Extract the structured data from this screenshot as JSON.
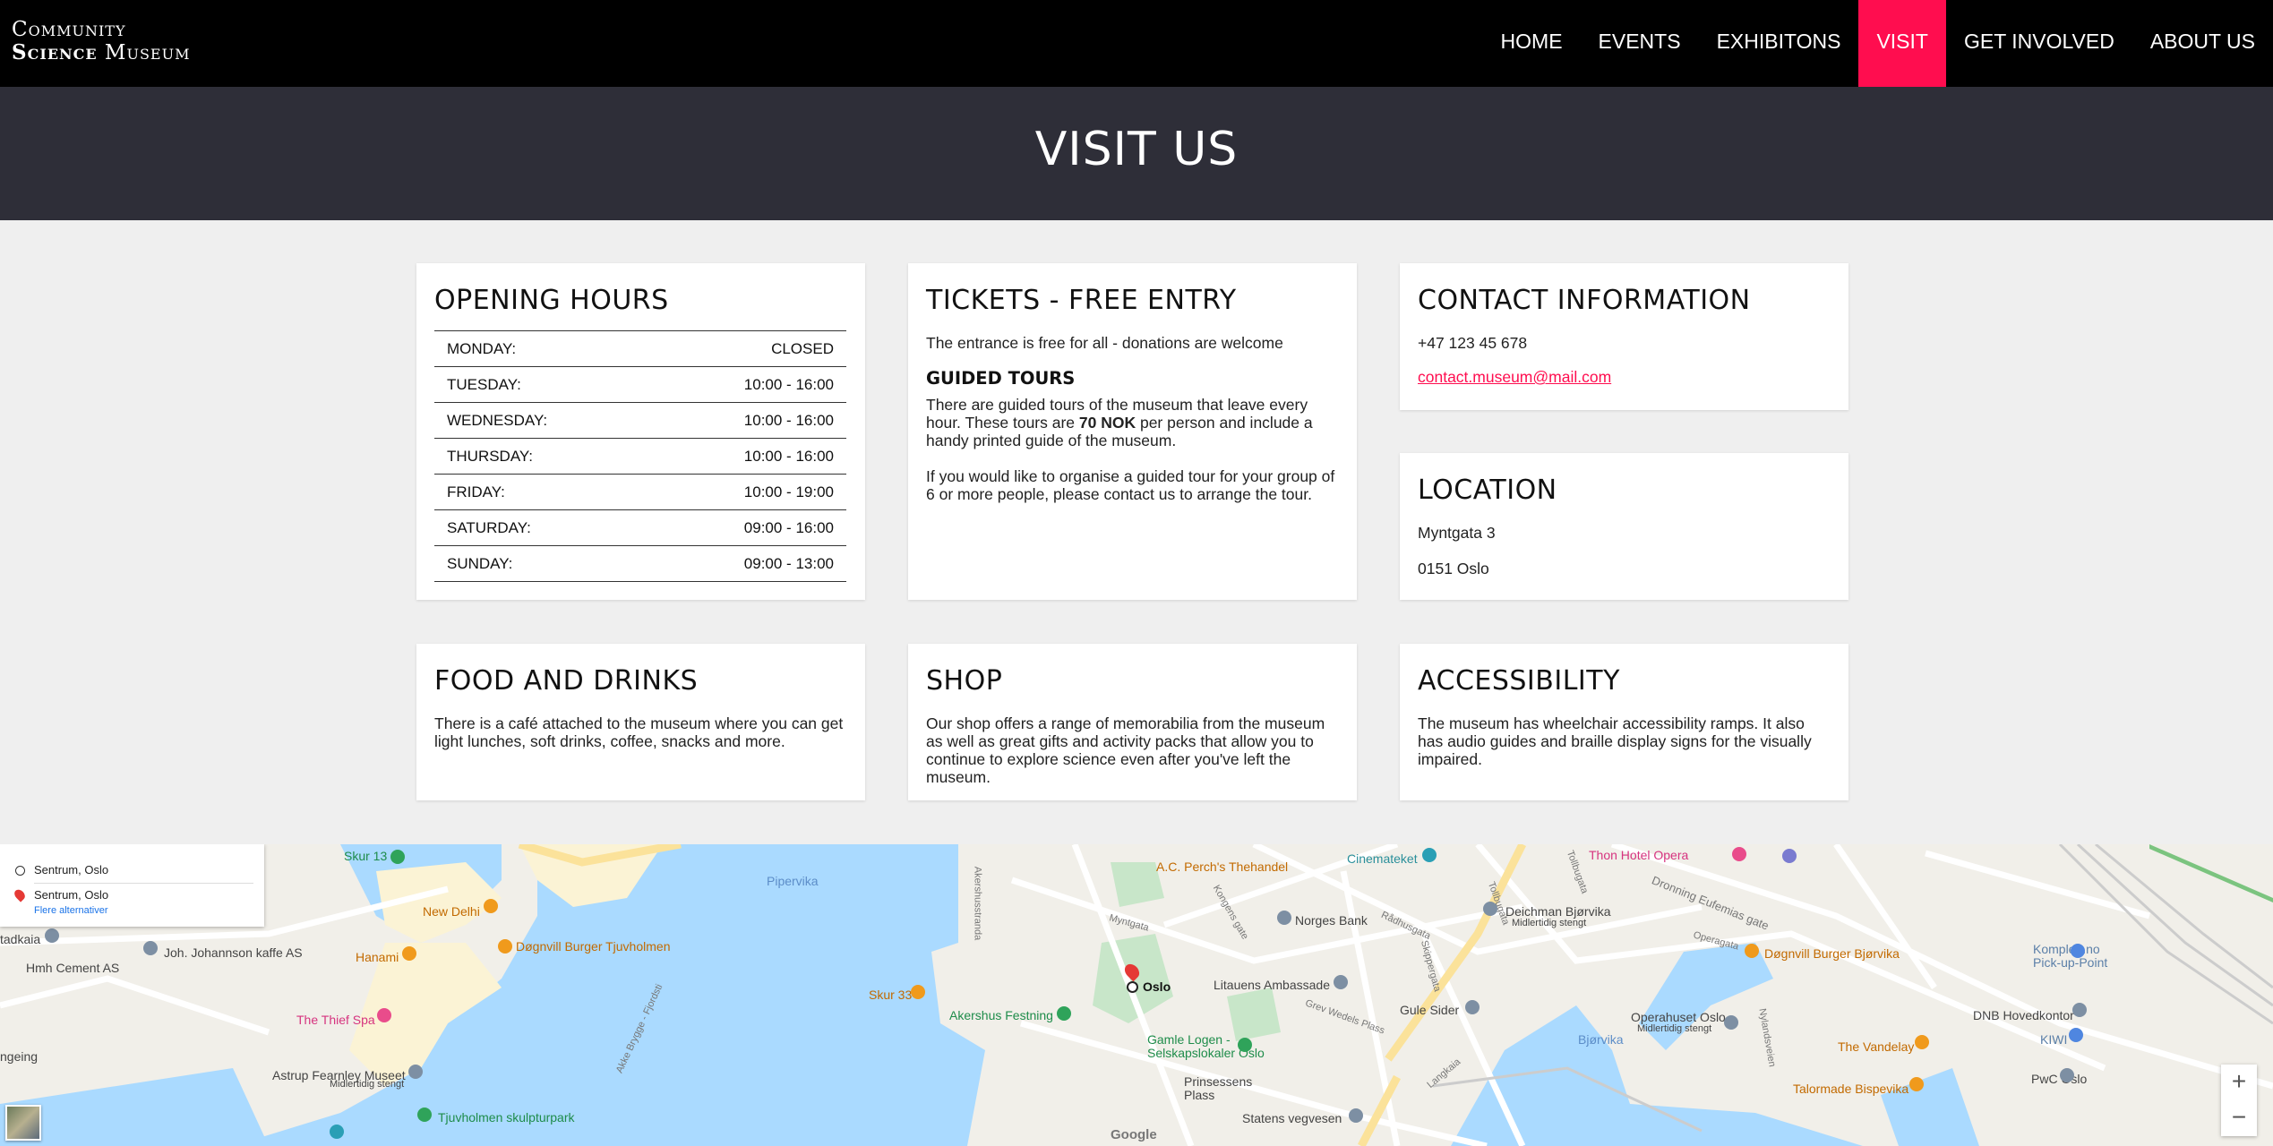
{
  "nav": {
    "logo_line1": "Community",
    "logo_line2_bold": "Science",
    "logo_line2_rest": "Museum",
    "items": [
      {
        "label": "HOME"
      },
      {
        "label": "EVENTS"
      },
      {
        "label": "EXHIBITONS"
      },
      {
        "label": "VISIT",
        "active": true
      },
      {
        "label": "GET INVOLVED"
      },
      {
        "label": "ABOUT US"
      }
    ],
    "active_color": "#ff0d4f"
  },
  "hero": {
    "title": "VISIT US"
  },
  "hours": {
    "title": "OPENING HOURS",
    "rows": [
      {
        "day": "MONDAY:",
        "time": "CLOSED"
      },
      {
        "day": "TUESDAY:",
        "time": "10:00 - 16:00"
      },
      {
        "day": "WEDNESDAY:",
        "time": "10:00 - 16:00"
      },
      {
        "day": "THURSDAY:",
        "time": "10:00 - 16:00"
      },
      {
        "day": "FRIDAY:",
        "time": "10:00 - 19:00"
      },
      {
        "day": "SATURDAY:",
        "time": "09:00 - 16:00"
      },
      {
        "day": "SUNDAY:",
        "time": "09:00 - 13:00"
      }
    ]
  },
  "tickets": {
    "title": "TICKETS - FREE ENTRY",
    "intro": "The entrance is free for all - donations are welcome",
    "tours_title": "GUIDED TOURS",
    "tours_p1_a": "There are guided tours of the museum that leave every hour. These tours are ",
    "tours_p1_bold": "70 NOK",
    "tours_p1_b": " per person and include a handy printed guide of the museum.",
    "tours_p2": "If you would like to organise a guided tour for your group of 6 or more people, please contact us to arrange the tour."
  },
  "contact": {
    "title": "CONTACT INFORMATION",
    "phone": "+47 123 45 678",
    "email": "contact.museum@mail.com"
  },
  "location": {
    "title": "LOCATION",
    "street": "Myntgata 3",
    "city": "0151 Oslo"
  },
  "food": {
    "title": "FOOD AND DRINKS",
    "text": "There is a café attached to the museum where you can get light lunches, soft drinks, coffee, snacks and more."
  },
  "shop": {
    "title": "SHOP",
    "text": "Our shop offers a range of memorabilia from the museum as well as great gifts and activity packs that allow you to continue to explore science even after you've left the museum."
  },
  "access": {
    "title": "ACCESSIBILITY",
    "text": "The museum has wheelchair accessibility ramps. It also has audio guides and braille display signs for the visually impaired."
  },
  "map": {
    "dir_from": "Sentrum, Oslo",
    "dir_to": "Sentrum, Oslo",
    "dir_more": "Flere alternativer",
    "pin_label": "Oslo",
    "labels": [
      "Skur 13",
      "Pipervika",
      "New Delhi",
      "Døgnvill Burger Tjuvholmen",
      "Hanami",
      "Joh. Johannson kaffe AS",
      "Hmh Cement AS",
      "tadkaia",
      "The Thief Spa",
      "ngeing",
      "Astrup Fearnley Museet",
      "Midlertidig stengt",
      "Tjuvholmen skulpturpark",
      "A.C. Perch's Thehandel",
      "Cinemateket",
      "Norges Bank",
      "Litauens Ambassade",
      "Skur 33",
      "Akershus Festning",
      "Gamle Logen - Selskapslokaler Oslo",
      "Prinsessens Plass",
      "Statens vegvesen",
      "Gule Sider",
      "Thon Hotel Opera",
      "Deichman Bjørvika",
      "Midlertidig stengt",
      "Døgnvill Burger Bjørvika",
      "Operahuset Oslo",
      "Midlertidig stengt",
      "Bjørvika",
      "The Vandelay",
      "Talormade Bispevika",
      "DNB Hovedkontor",
      "KIWI",
      "PwC Oslo",
      "Komplett.no Pick-up-Point",
      "Google",
      "Myntgata",
      "Kongens gate",
      "Rådhusgata",
      "Skippergata",
      "Tollbugata",
      "Dronning Eufemias gate",
      "Akershusstranda",
      "Akke Brygge - Fjordsti",
      "Grev Wedels Plass",
      "Langkaia",
      "Operagata",
      "Nylandsveien",
      "Tollbugata"
    ],
    "zoom_in": "+",
    "zoom_out": "−",
    "colors": {
      "water": "#aadaff",
      "land": "#f1efe9",
      "park": "#c8e6c9",
      "road": "#ffffff",
      "major_road": "#fbe29a"
    }
  }
}
